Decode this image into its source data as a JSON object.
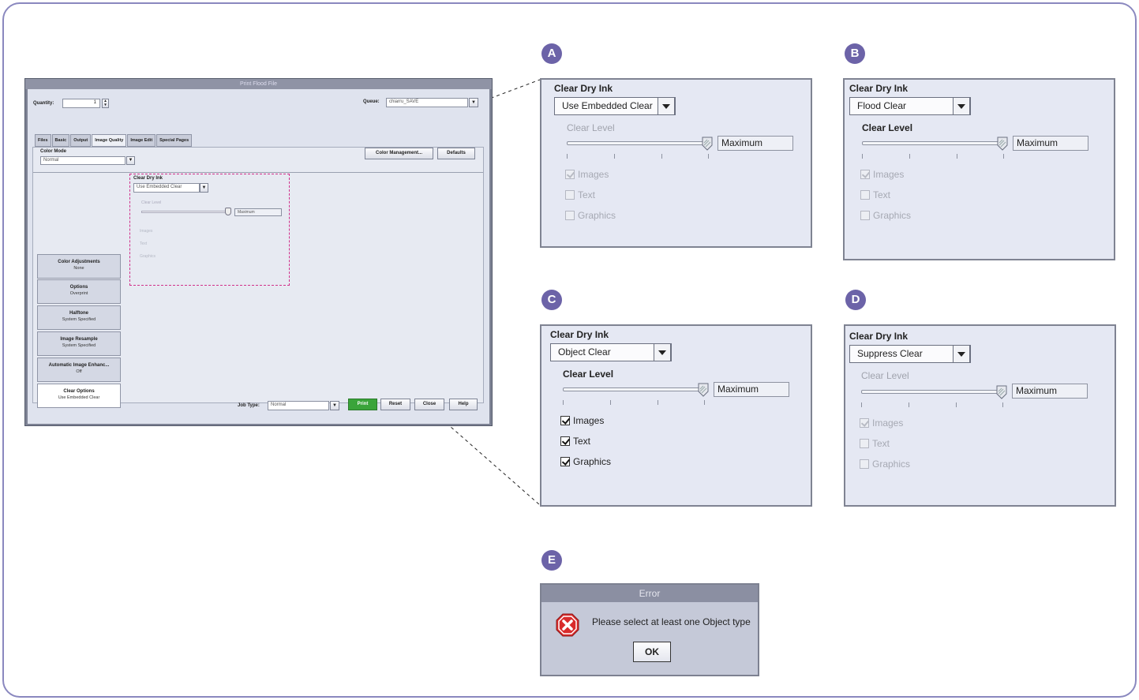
{
  "window": {
    "title": "Print Flood File",
    "quantity_label": "Quantity:",
    "quantity_value": "1",
    "queue_label": "Queue:",
    "queue_value": "chiarru_SAVE",
    "tabs": [
      "Files",
      "Basic",
      "Output",
      "Image Quality",
      "Image Edit",
      "Special Pages"
    ],
    "color_mode_label": "Color Mode",
    "color_mode_value": "Normal",
    "color_management_button": "Color Management...",
    "defaults_button": "Defaults",
    "sidebar": [
      {
        "title": "Color Adjustments",
        "sub": "None"
      },
      {
        "title": "Options",
        "sub": "Overprint"
      },
      {
        "title": "Halftone",
        "sub": "System Specified"
      },
      {
        "title": "Image Resample",
        "sub": "System Specified"
      },
      {
        "title": "Automatic Image Enhanc...",
        "sub": "Off"
      },
      {
        "title": "Clear Options",
        "sub": "Use Embedded Clear"
      }
    ],
    "mini": {
      "heading": "Clear Dry Ink",
      "dropdown": "Use Embedded Clear",
      "clear_level": "Clear Level",
      "value": "Maximum",
      "checks": [
        "Images",
        "Text",
        "Graphics"
      ]
    },
    "job_type_label": "Job Type:",
    "job_type_value": "Normal",
    "buttons": {
      "print": "Print",
      "reset": "Reset",
      "close": "Close",
      "help": "Help"
    }
  },
  "panels": [
    {
      "badge": "A",
      "heading": "Clear Dry Ink",
      "dropdown": "Use Embedded Clear",
      "clear_level": "Clear Level",
      "value": "Maximum",
      "images": "Images",
      "text": "Text",
      "graphics": "Graphics"
    },
    {
      "badge": "B",
      "heading": "Clear Dry Ink",
      "dropdown": "Flood Clear",
      "clear_level": "Clear Level",
      "value": "Maximum",
      "images": "Images",
      "text": "Text",
      "graphics": "Graphics"
    },
    {
      "badge": "C",
      "heading": "Clear Dry Ink",
      "dropdown": "Object Clear",
      "clear_level": "Clear Level",
      "value": "Maximum",
      "images": "Images",
      "text": "Text",
      "graphics": "Graphics"
    },
    {
      "badge": "D",
      "heading": "Clear Dry Ink",
      "dropdown": "Suppress Clear",
      "clear_level": "Clear Level",
      "value": "Maximum",
      "images": "Images",
      "text": "Text",
      "graphics": "Graphics"
    }
  ],
  "error": {
    "badge": "E",
    "title": "Error",
    "message": "Please select at least one Object type",
    "ok": "OK"
  },
  "colors": {
    "badge": "#6c63a8",
    "frame": "#8a88bf",
    "highlight": "#d0308a",
    "print_button": "#3aa43a"
  }
}
